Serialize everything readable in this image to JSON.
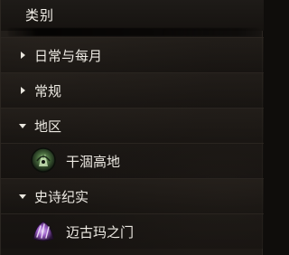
{
  "panel": {
    "title": "类别"
  },
  "rows": [
    {
      "type": "category",
      "label": "日常与每月",
      "expanded": false
    },
    {
      "type": "category",
      "label": "常规",
      "expanded": false
    },
    {
      "type": "category",
      "label": "地区",
      "expanded": true
    },
    {
      "type": "entry",
      "label": "干涸高地",
      "icon": "mossy-helm-icon"
    },
    {
      "type": "category",
      "label": "史诗纪实",
      "expanded": true
    },
    {
      "type": "entry",
      "label": "迈古玛之门",
      "icon": "purple-claw-icon"
    }
  ],
  "colors": {
    "background": "#151210",
    "text": "#ece9e2",
    "divider": "#2a2520"
  }
}
